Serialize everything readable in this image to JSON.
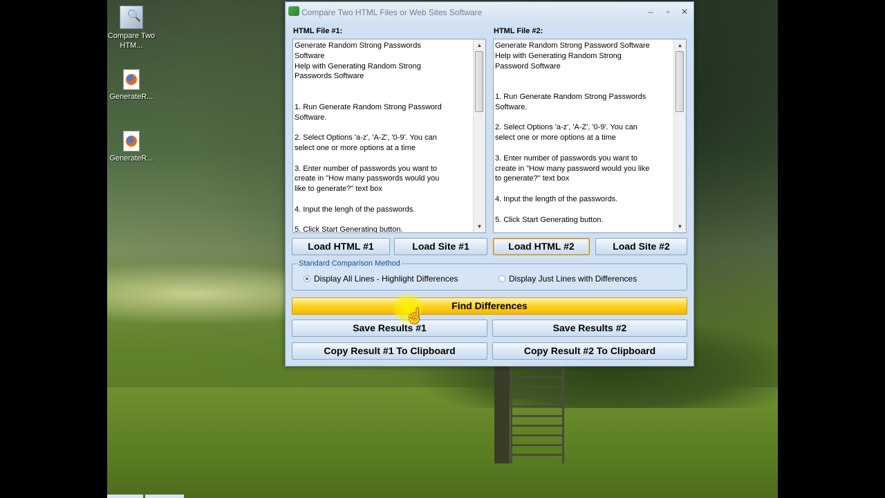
{
  "desktop": {
    "icons": [
      {
        "label": "Compare Two HTM..."
      },
      {
        "label": "GenerateR..."
      },
      {
        "label": "GenerateR..."
      }
    ]
  },
  "window": {
    "title": "Compare Two HTML Files or Web Sites Software",
    "controls": {
      "minimize": "–",
      "maximize": "▫",
      "close": "✕"
    }
  },
  "panels": {
    "left_label": "HTML File #1:",
    "right_label": "HTML File #2:",
    "left_text": "Generate Random Strong Passwords\nSoftware\nHelp with Generating Random Strong\nPasswords Software\n\n\n1. Run Generate Random Strong Password\nSoftware.\n\n2. Select Options 'a-z', 'A-Z', '0-9'. You can\nselect one or more options at a time\n\n3. Enter number of passwords you want to\ncreate in \"How many passwords would you\nlike to generate?\" text box\n\n4. Input the lengh of the passwords.\n\n5. Click Start Generating button.",
    "right_text": "Generate Random Strong Password Software\nHelp with Generating Random Strong\nPassword Software\n\n\n1. Run Generate Random Strong Passwords\nSoftware.\n\n2. Select Options 'a-z', 'A-Z', '0-9'. You can\nselect one or more options at a time\n\n3. Enter number of passwords you want to\ncreate in \"How many password would you like\nto generate?\" text box\n\n4. Input the length of the passwords.\n\n5. Click Start Generating button."
  },
  "buttons": {
    "load_html_1": "Load HTML #1",
    "load_site_1": "Load Site #1",
    "load_html_2": "Load HTML #2",
    "load_site_2": "Load Site #2",
    "find": "Find Differences",
    "save_1": "Save Results #1",
    "save_2": "Save Results #2",
    "copy_1": "Copy Result #1  To Clipboard",
    "copy_2": "Copy Result #2  To Clipboard"
  },
  "comparison": {
    "group_title": "Standard Comparison Method",
    "option_all": "Display All Lines - Highlight Differences",
    "option_diff": "Display Just Lines with Differences",
    "selected": "option_all"
  }
}
